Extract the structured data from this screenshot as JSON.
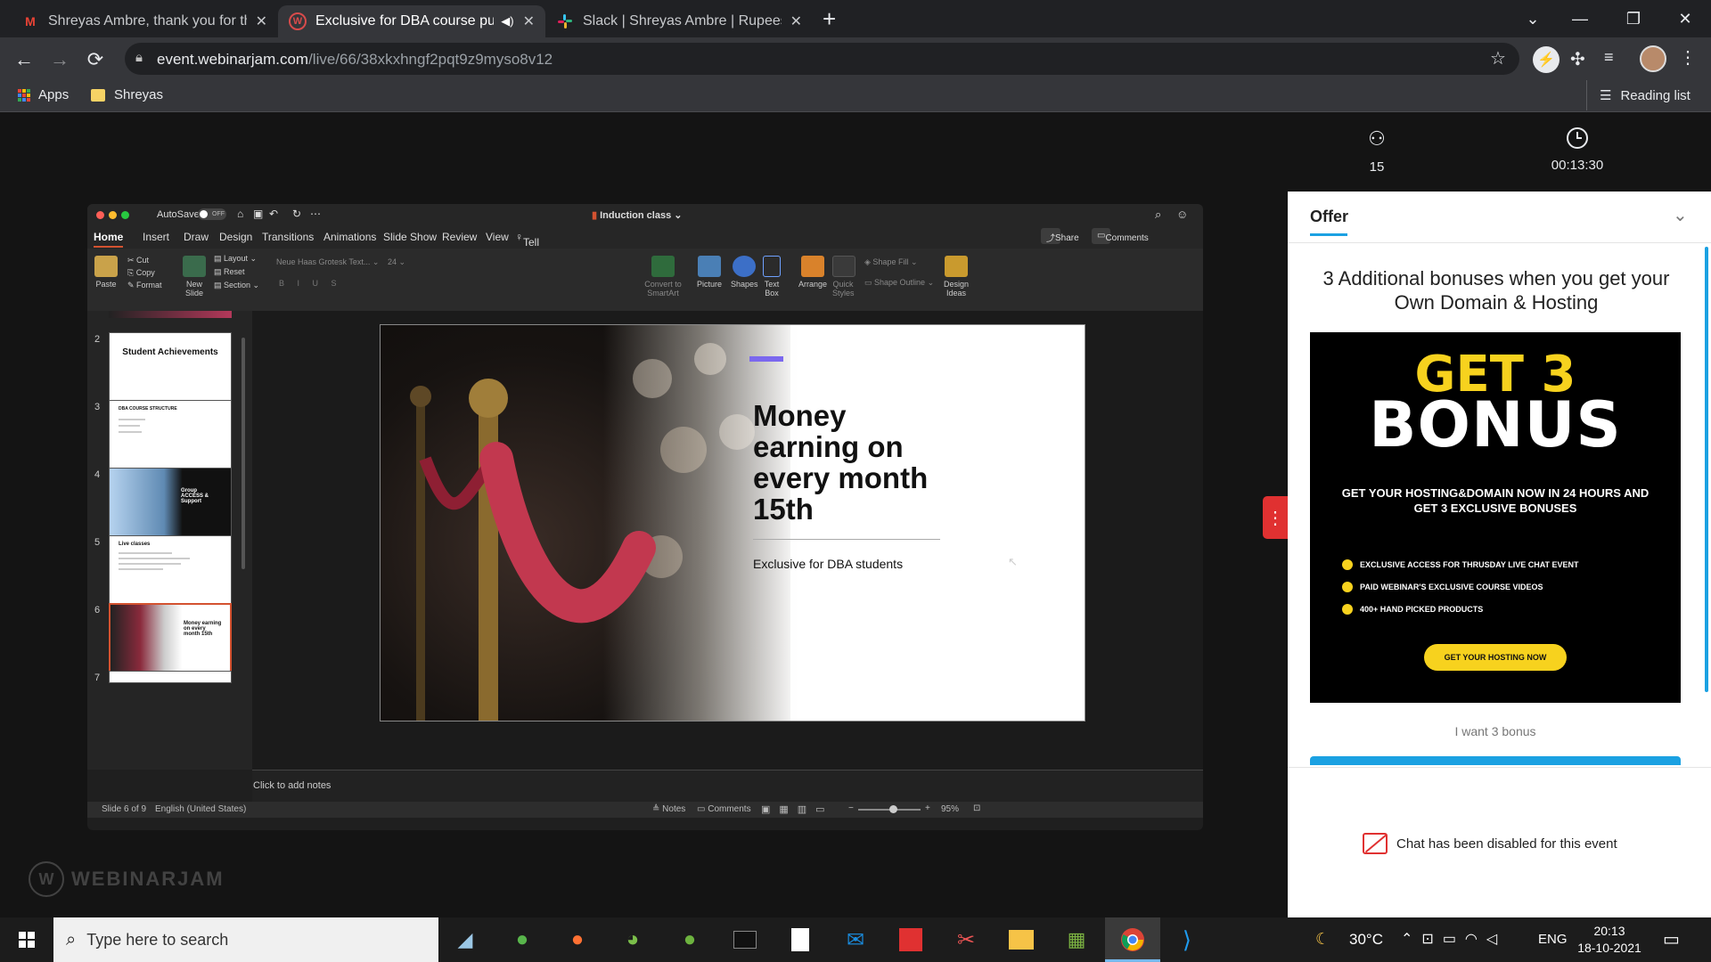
{
  "browser": {
    "tabs": [
      {
        "title": "Shreyas Ambre, thank you for the",
        "favicon": "gmail-icon"
      },
      {
        "title": "Exclusive for DBA course pur",
        "favicon": "webinarjam-icon",
        "audio": "speaker-icon"
      },
      {
        "title": "Slack | Shreyas Ambre | Rupeese",
        "favicon": "slack-icon"
      }
    ],
    "new_tab": "+",
    "url_host": "event.webinarjam.com",
    "url_path": "/live/66/38xkxhngf2pqt9z9myso8v12",
    "bookmarks": [
      "Apps",
      "Shreyas"
    ],
    "reading_list": "Reading list"
  },
  "ppt": {
    "autosave": "AutoSave",
    "autosave_state": "OFF",
    "doc_title": "Induction class",
    "tabs": [
      "Home",
      "Insert",
      "Draw",
      "Design",
      "Transitions",
      "Animations",
      "Slide Show",
      "Review",
      "View"
    ],
    "tell_me": "Tell me",
    "share": "Share",
    "comments": "Comments",
    "ribbon": {
      "paste": "Paste",
      "cut": "Cut",
      "copy": "Copy",
      "format": "Format",
      "new_slide": "New Slide",
      "layout": "Layout",
      "reset": "Reset",
      "section": "Section",
      "font": "Neue Haas Grotesk Text...",
      "size": "24",
      "convert_smartart": "Convert to SmartArt",
      "picture": "Picture",
      "shapes": "Shapes",
      "text_box": "Text Box",
      "arrange": "Arrange",
      "quick_styles": "Quick Styles",
      "shape_fill": "Shape Fill",
      "shape_outline": "Shape Outline",
      "design_ideas": "Design Ideas"
    },
    "thumbnails": [
      {
        "num": "2",
        "title": "Student Achievements"
      },
      {
        "num": "3",
        "title": "DBA COURSE STRUCTURE"
      },
      {
        "num": "4",
        "title": "Group ACCESS & Support"
      },
      {
        "num": "5",
        "title": "Live classes"
      },
      {
        "num": "6",
        "title": "Money earning on every month 15th"
      },
      {
        "num": "7",
        "title": ""
      }
    ],
    "slide": {
      "headline": "Money earning on every month 15th",
      "subtitle": "Exclusive for DBA students"
    },
    "notes_placeholder": "Click to add notes",
    "status": {
      "slide_count": "Slide 6 of 9",
      "language": "English (United States)",
      "notes": "Notes",
      "comments": "Comments",
      "zoom": "95%",
      "zoom_level": 0.55
    }
  },
  "webinarjam_logo": "WEBINARJAM",
  "panel": {
    "attendees": "15",
    "timer": "00:13:30",
    "offer_tab": "Offer",
    "offer_title": "3 Additional bonuses when you get your Own Domain & Hosting",
    "bonus": {
      "line1": "GET 3",
      "line2": "BONUS",
      "headline": "GET YOUR HOSTING&DOMAIN NOW IN 24 HOURS AND GET 3 EXCLUSIVE BONUSES",
      "bullets": [
        "EXCLUSIVE ACCESS FOR THRUSDAY LIVE CHAT EVENT",
        "PAID WEBINAR'S EXCLUSIVE COURSE VIDEOS",
        "400+ HAND PICKED PRODUCTS"
      ],
      "cta": "GET YOUR HOSTING NOW"
    },
    "caption": "I want 3 bonus",
    "chat_disabled": "Chat has been disabled for this event"
  },
  "taskbar": {
    "search_placeholder": "Type here to search",
    "weather": "30°C",
    "language": "ENG",
    "time": "20:13",
    "date": "18-10-2021"
  },
  "colors": {
    "accent_purple": "#7b68ee",
    "offer_blue": "#1ba1e2",
    "bonus_yellow": "#f7d21e",
    "chat_red": "#e03131"
  }
}
